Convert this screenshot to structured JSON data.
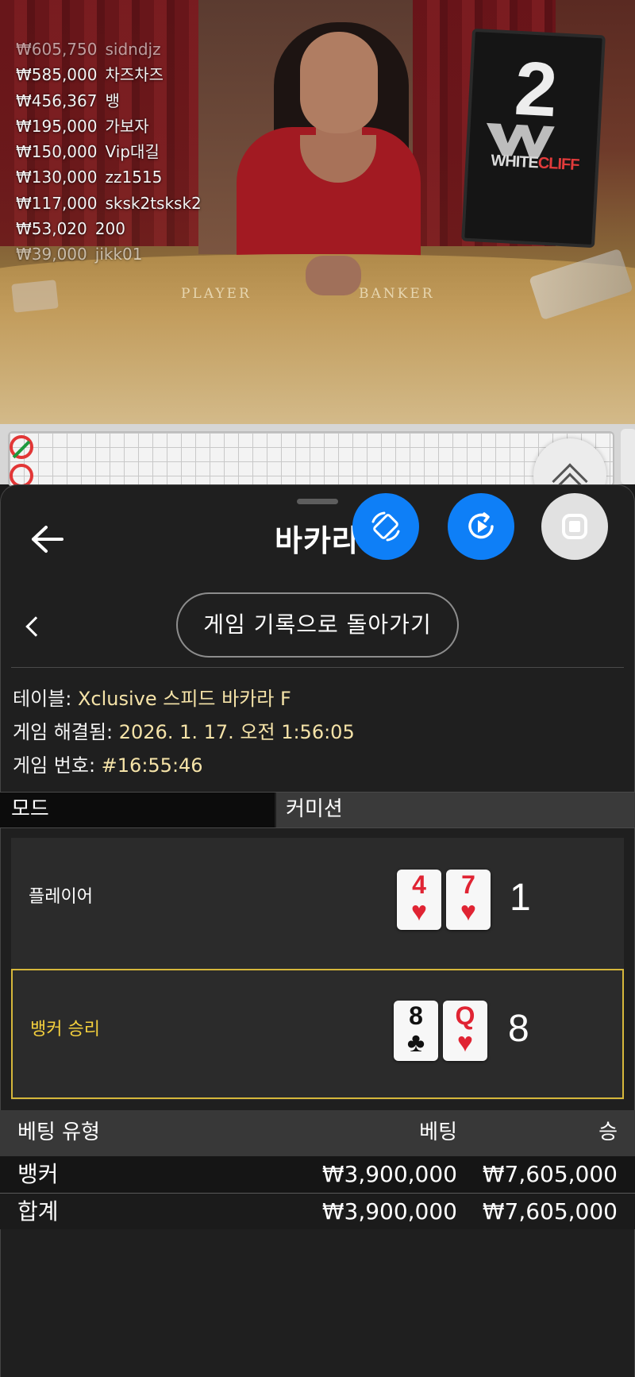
{
  "video": {
    "table_labels": {
      "player": "PLAYER",
      "banker": "BANKER"
    },
    "monitor": {
      "round_number": "2",
      "brand_white": "WHITE",
      "brand_cliff": "CLIFF"
    },
    "ticker": [
      {
        "amount": "₩605,750",
        "user": "sidndjz"
      },
      {
        "amount": "₩585,000",
        "user": "차즈차즈"
      },
      {
        "amount": "₩456,367",
        "user": "뱅"
      },
      {
        "amount": "₩195,000",
        "user": "가보자"
      },
      {
        "amount": "₩150,000",
        "user": "Vip대길"
      },
      {
        "amount": "₩130,000",
        "user": "zz1515"
      },
      {
        "amount": "₩117,000",
        "user": "sksk2tsksk2"
      },
      {
        "amount": "₩53,020",
        "user": "200"
      },
      {
        "amount": "₩39,000",
        "user": "jikk01"
      }
    ]
  },
  "header": {
    "title": "바카라"
  },
  "nav": {
    "back_to_history": "게임 기록으로 돌아가기"
  },
  "game_info": {
    "table_label": "테이블: ",
    "table_value": "Xclusive 스피드 바카라 F",
    "resolved_label": "게임 해결됨: ",
    "resolved_value": "2026. 1. 17. 오전 1:56:05",
    "number_label": "게임 번호: ",
    "number_value": "#16:55:46"
  },
  "tabs": {
    "mode": "모드",
    "commission": "커미션"
  },
  "hands": {
    "player": {
      "label": "플레이어",
      "cards": [
        {
          "rank": "4",
          "suit": "♥"
        },
        {
          "rank": "7",
          "suit": "♥"
        }
      ],
      "score": "1"
    },
    "banker": {
      "label": "뱅커 승리",
      "cards": [
        {
          "rank": "8",
          "suit": "♣"
        },
        {
          "rank": "Q",
          "suit": "♥"
        }
      ],
      "score": "8"
    }
  },
  "bets": {
    "headers": {
      "type": "베팅 유형",
      "bet": "베팅",
      "win": "승"
    },
    "rows": [
      {
        "type": "뱅커",
        "bet": "₩3,900,000",
        "win": "₩7,605,000"
      }
    ],
    "total": {
      "type": "합계",
      "bet": "₩3,900,000",
      "win": "₩7,605,000"
    }
  },
  "colors": {
    "accent_blue": "#0e7ff7",
    "winner_gold": "#d6b73b",
    "info_value": "#f5e3a8",
    "card_red": "#e02433"
  },
  "icons": {
    "back": "arrow-left-icon",
    "rotate": "rotate-screen-icon",
    "replay": "replay-icon",
    "stop": "stop-icon",
    "expand": "chevron-up-double-icon",
    "prev": "chevron-left-icon"
  }
}
